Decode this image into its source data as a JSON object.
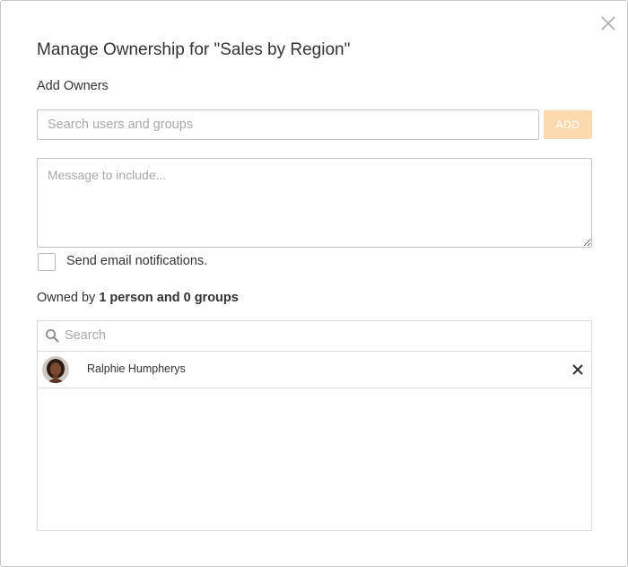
{
  "dialog": {
    "title": "Manage Ownership for \"Sales by Region\"",
    "add_owners_label": "Add Owners",
    "search_placeholder": "Search users and groups",
    "add_button_label": "ADD",
    "message_placeholder": "Message to include...",
    "notify_label": "Send email notifications.",
    "notify_checked": false
  },
  "owned_by": {
    "prefix": "Owned by ",
    "summary": "1 person and 0 groups"
  },
  "owners_list": {
    "search_placeholder": "Search",
    "owners": [
      {
        "name": "Ralphie Humpherys"
      }
    ]
  },
  "colors": {
    "add_button_bg": "#fdd9b0",
    "border": "#c4c4c4"
  }
}
